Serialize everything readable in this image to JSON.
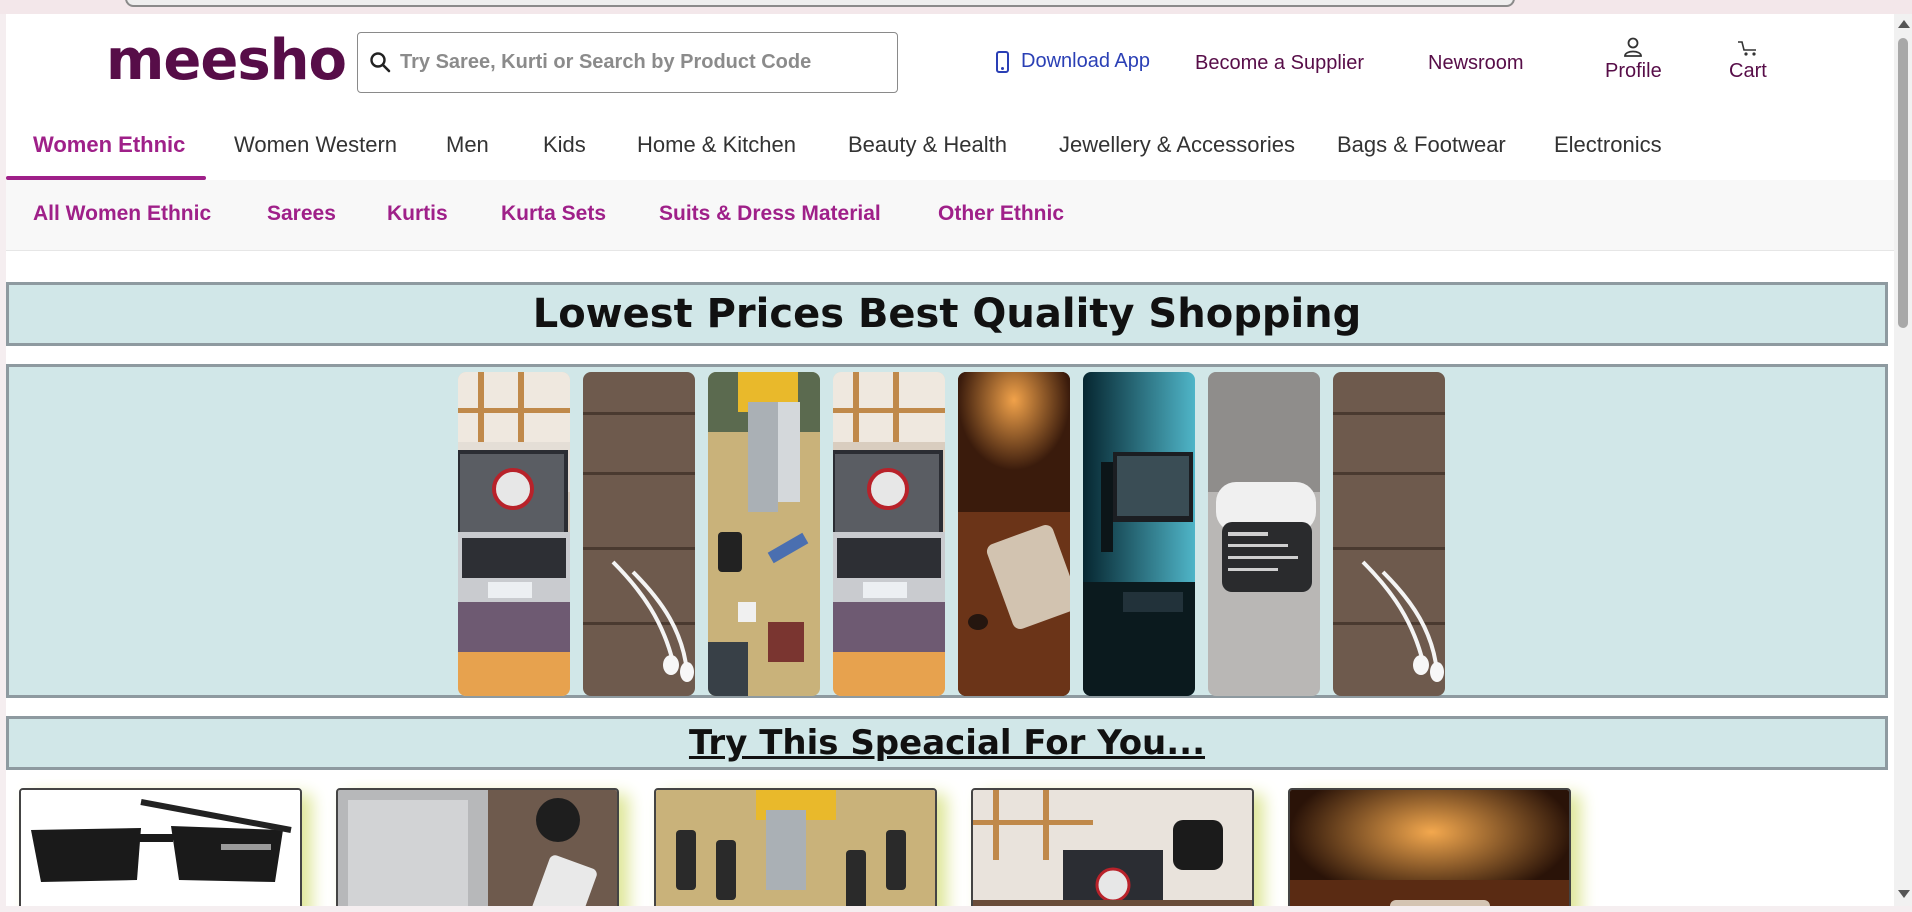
{
  "header": {
    "logo": "meesho",
    "search_placeholder": "Try Saree, Kurti or Search by Product Code",
    "download_app": "Download App",
    "become_supplier": "Become a Supplier",
    "newsroom": "Newsroom",
    "profile": "Profile",
    "cart": "Cart"
  },
  "categories": [
    "Women Ethnic",
    "Women Western",
    "Men",
    "Kids",
    "Home & Kitchen",
    "Beauty & Health",
    "Jewellery & Accessories",
    "Bags & Footwear",
    "Electronics"
  ],
  "subcategories": [
    "All Women Ethnic",
    "Sarees",
    "Kurtis",
    "Kurta Sets",
    "Suits & Dress Material",
    "Other Ethnic"
  ],
  "banner_title": "Lowest Prices Best Quality Shopping",
  "special_title": "Try This Speacial For You...",
  "gallery": [
    "laptop-desk-image",
    "earphones-wood-image",
    "circuit-board-image",
    "laptop-desk-image",
    "phone-table-image",
    "monitor-setup-image",
    "camera-device-image",
    "earphones-wood-image"
  ],
  "products": [
    "sunglasses-image",
    "laptop-phone-image",
    "circuit-board-image",
    "desk-workspace-image",
    "phone-table-image"
  ],
  "colors": {
    "brand": "#570d48",
    "accent": "#9f2089",
    "banner_bg": "#d1e7e8"
  }
}
